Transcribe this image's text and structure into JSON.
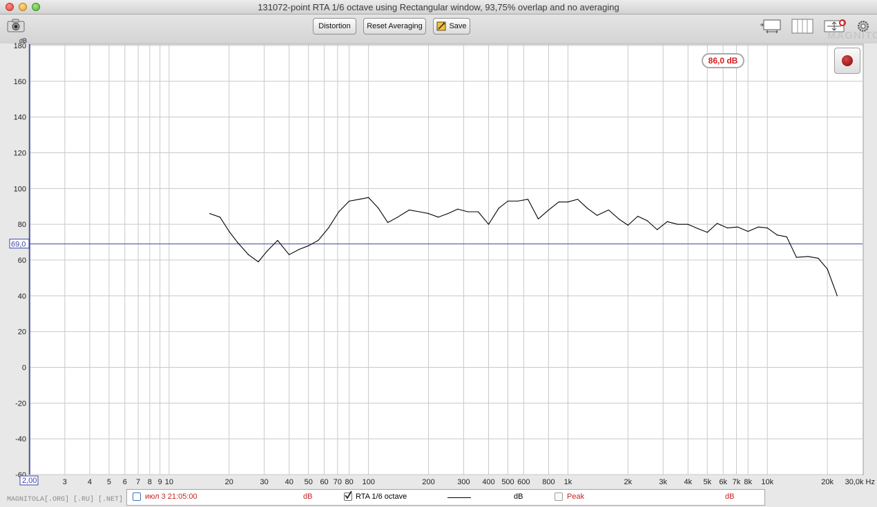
{
  "window": {
    "title": "131072-point RTA 1/6 octave using Rectangular window, 93,75% overlap and no averaging"
  },
  "toolbar": {
    "distortion_label": "Distortion",
    "reset_label": "Reset Averaging",
    "save_label": "Save",
    "icons": [
      "camera-icon",
      "graph-layout-icon",
      "columns-icon",
      "zoom-arrows-icon",
      "gear-icon"
    ]
  },
  "watermark_top": "MAGNITOLA",
  "spl_readout": "86,0 dB",
  "cursor_value": "69,0",
  "x_axis_start_label": "2,00",
  "legend": {
    "item1_label": "июл 3 21:05:00",
    "item1_unit": "dB",
    "item2_label": "RTA 1/6 octave",
    "item2_unit": "dB",
    "item3_label": "Peak",
    "item3_unit": "dB"
  },
  "watermark_bottom": "MAGNITOLA[.ORG] [.RU] [.NET]",
  "colors": {
    "trace": "#000000",
    "cursor": "#3b43a8",
    "grid": "#c8c8c8",
    "peak_text": "#c92020",
    "legend_date": "#c92020"
  },
  "chart_data": {
    "type": "line",
    "x_scale": "log",
    "xlim": [
      2,
      30000
    ],
    "ylim": [
      -60,
      180
    ],
    "ylabel": "dB",
    "xunit": "Hz",
    "y_ticks": [
      -60,
      -40,
      -20,
      0,
      20,
      40,
      60,
      80,
      100,
      120,
      140,
      160,
      180
    ],
    "x_tick_labels": [
      {
        "v": 3,
        "t": "3"
      },
      {
        "v": 4,
        "t": "4"
      },
      {
        "v": 5,
        "t": "5"
      },
      {
        "v": 6,
        "t": "6"
      },
      {
        "v": 7,
        "t": "7"
      },
      {
        "v": 8,
        "t": "8"
      },
      {
        "v": 9,
        "t": "9"
      },
      {
        "v": 10,
        "t": "10"
      },
      {
        "v": 20,
        "t": "20"
      },
      {
        "v": 30,
        "t": "30"
      },
      {
        "v": 40,
        "t": "40"
      },
      {
        "v": 50,
        "t": "50"
      },
      {
        "v": 60,
        "t": "60"
      },
      {
        "v": 70,
        "t": "70"
      },
      {
        "v": 80,
        "t": "80"
      },
      {
        "v": 100,
        "t": "100"
      },
      {
        "v": 200,
        "t": "200"
      },
      {
        "v": 300,
        "t": "300"
      },
      {
        "v": 400,
        "t": "400"
      },
      {
        "v": 500,
        "t": "500"
      },
      {
        "v": 600,
        "t": "600"
      },
      {
        "v": 800,
        "t": "800"
      },
      {
        "v": 1000,
        "t": "1k"
      },
      {
        "v": 2000,
        "t": "2k"
      },
      {
        "v": 3000,
        "t": "3k"
      },
      {
        "v": 4000,
        "t": "4k"
      },
      {
        "v": 5000,
        "t": "5k"
      },
      {
        "v": 6000,
        "t": "6k"
      },
      {
        "v": 7000,
        "t": "7k"
      },
      {
        "v": 8000,
        "t": "8k"
      },
      {
        "v": 10000,
        "t": "10k"
      },
      {
        "v": 20000,
        "t": "20k"
      },
      {
        "v": 30000,
        "t": "30,0k Hz"
      }
    ],
    "cursor_y": 69,
    "series": [
      {
        "x": [
          16,
          18,
          20,
          22,
          25,
          28,
          31,
          35,
          40,
          45,
          50,
          56,
          63,
          71,
          80,
          90,
          100,
          112,
          125,
          140,
          160,
          180,
          200,
          224,
          250,
          280,
          315,
          355,
          400,
          450,
          500,
          560,
          630,
          710,
          800,
          900,
          1000,
          1120,
          1250,
          1400,
          1600,
          1800,
          2000,
          2240,
          2500,
          2800,
          3150,
          3550,
          4000,
          4500,
          5000,
          5600,
          6300,
          7100,
          8000,
          9000,
          10000,
          11200,
          12500,
          14000,
          16000,
          18000,
          20000,
          22400
        ],
        "y": [
          86,
          84,
          76,
          70,
          63,
          59,
          65,
          71,
          63,
          66,
          68,
          71,
          78,
          87,
          93,
          94,
          95,
          89,
          81,
          84,
          88,
          87,
          86,
          84,
          86,
          88.5,
          87,
          87,
          80,
          89,
          93,
          93,
          94,
          83,
          88,
          92.5,
          92.5,
          94,
          89,
          85,
          88,
          83,
          79.5,
          84.5,
          82,
          77,
          81.5,
          80,
          80,
          77.5,
          75.5,
          80.5,
          78,
          78.5,
          76,
          78.5,
          78,
          74,
          73,
          61.5,
          62,
          61,
          55,
          40
        ]
      }
    ]
  }
}
